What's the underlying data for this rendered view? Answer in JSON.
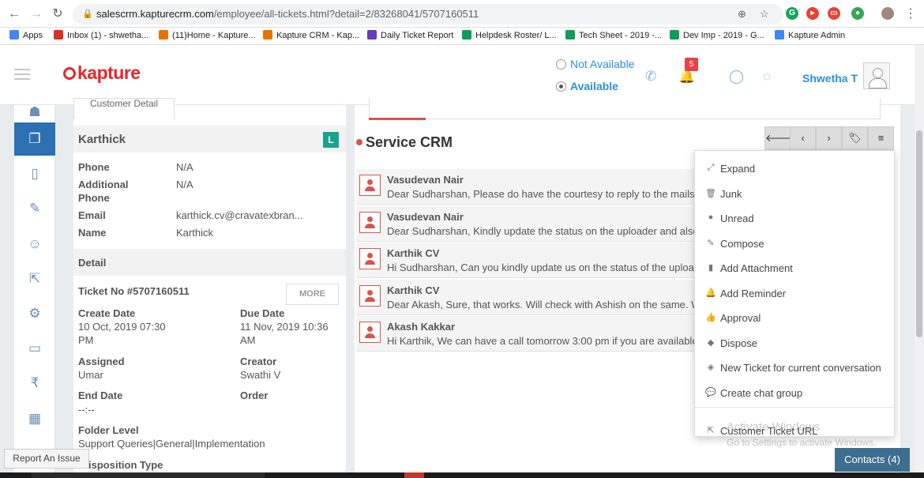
{
  "browser": {
    "url_host": "salescrm.kapturecrm.com",
    "url_path": "/employee/all-tickets.html?detail=2/83268041/5707160511",
    "bookmarks": [
      {
        "label": "Apps",
        "color": "#4285f4"
      },
      {
        "label": "Inbox (1) - shwetha...",
        "color": "#d93025"
      },
      {
        "label": "(11)Home - Kapture...",
        "color": "#e37400"
      },
      {
        "label": "Kapture CRM - Kap...",
        "color": "#e37400"
      },
      {
        "label": "Daily Ticket Report",
        "color": "#673ab7"
      },
      {
        "label": "Helpdesk Roster/ L...",
        "color": "#0f9d58"
      },
      {
        "label": "Tech Sheet - 2019 -...",
        "color": "#0f9d58"
      },
      {
        "label": "Dev Imp - 2019 - G...",
        "color": "#0f9d58"
      },
      {
        "label": "Kapture Admin",
        "color": "#4285f4"
      }
    ]
  },
  "header": {
    "logo": "kapture",
    "status_not_available": "Not Available",
    "status_available": "Available",
    "notification_count": "5",
    "user_name": "Shwetha T"
  },
  "customer": {
    "tab_label": "Customer Detail",
    "name": "Karthick",
    "badge": "L",
    "fields": [
      {
        "label": "Phone",
        "value": "N/A"
      },
      {
        "label": "Additional",
        "label2": "Phone",
        "value": "N/A"
      },
      {
        "label": "Email",
        "value": "karthick.cv@cravatexbran..."
      },
      {
        "label": "Name",
        "value": "Karthick"
      }
    ],
    "detail_heading": "Detail",
    "ticket_no": "Ticket No #5707160511",
    "more_label": "MORE",
    "create_date_label": "Create Date",
    "create_date_value": "10 Oct, 2019 07:30",
    "create_date_value2": "PM",
    "due_date_label": "Due Date",
    "due_date_value": "11 Nov, 2019 10:36",
    "due_date_value2": "AM",
    "assigned_label": "Assigned",
    "assigned_value": "Umar",
    "creator_label": "Creator",
    "creator_value": "Swathi V",
    "end_date_label": "End Date",
    "end_date_value": "--:--",
    "order_label": "Order",
    "folder_label": "Folder Level",
    "folder_value": "Support Queries|General|Implementation",
    "disposition_label": "isposition Type"
  },
  "service": {
    "title": "Service CRM",
    "messages": [
      {
        "sender": "Vasudevan Nair",
        "text": "Dear Sudharshan, Please do have the courtesy to reply to the mails,"
      },
      {
        "sender": "Vasudevan Nair",
        "text": "Dear Sudharshan,  Kindly update the status on the uploader and also"
      },
      {
        "sender": "Karthik CV",
        "text": "Hi Sudharshan, Can you kindly update us on the status of the uploade"
      },
      {
        "sender": "Karthik CV",
        "text": "Dear Akash, Sure, that works. Will check with Ashish on the same. Wi"
      },
      {
        "sender": "Akash Kakkar",
        "text": "Hi Karthik, We can have a call tomorrow 3:00 pm if you are available,"
      }
    ]
  },
  "menu": {
    "items": [
      {
        "label": "Expand",
        "icon": "expand-icon",
        "glyph": "⤢"
      },
      {
        "label": "Junk",
        "icon": "trash-icon",
        "glyph": "🗑"
      },
      {
        "label": "Unread",
        "icon": "circle-icon",
        "glyph": "●"
      },
      {
        "label": "Compose",
        "icon": "edit-icon",
        "glyph": "✎"
      },
      {
        "label": "Add Attachment",
        "icon": "file-icon",
        "glyph": "▮"
      },
      {
        "label": "Add Reminder",
        "icon": "bell-icon",
        "glyph": "🔔"
      },
      {
        "label": "Approval",
        "icon": "thumbs-up-icon",
        "glyph": "👍"
      },
      {
        "label": "Dispose",
        "icon": "tag-icon",
        "glyph": "◆"
      },
      {
        "label": "New Ticket for current conversation",
        "icon": "tag-icon",
        "glyph": "◈"
      },
      {
        "label": "Create chat group",
        "icon": "chat-icon",
        "glyph": "💬"
      }
    ],
    "customer_ticket_url": "Customer Ticket URL"
  },
  "footer": {
    "report_issue": "Report An Issue",
    "contacts": "Contacts (4)",
    "watermark_title": "Activate Windows",
    "watermark_sub": "Go to Settings to activate Windows."
  },
  "colors": {
    "brand_red": "#e8262a",
    "link_blue": "#2c8ed6",
    "rail_active": "#2c6fb3",
    "accent_red": "#d9534f"
  }
}
